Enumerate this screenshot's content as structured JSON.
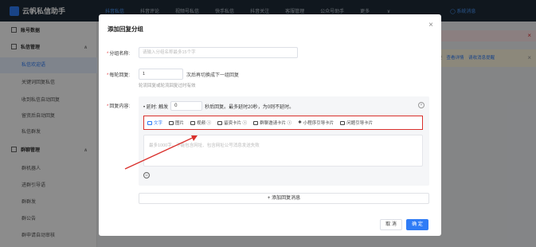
{
  "app": {
    "title": "云帆私信助手",
    "right_link": "系统消息"
  },
  "topnav": [
    "抖音私信",
    "抖音评论",
    "视频号私信",
    "快手私信",
    "抖音关注",
    "客服管理",
    "公众号助手",
    "更多"
  ],
  "sidebar": {
    "items": [
      {
        "label": "账号数据",
        "type": "group"
      },
      {
        "label": "私信管理",
        "type": "group"
      },
      {
        "label": "私信欢迎语",
        "type": "item",
        "active": true
      },
      {
        "label": "关键词回复私信",
        "type": "item"
      },
      {
        "label": "收到私信自动回复",
        "type": "item"
      },
      {
        "label": "留资后自动回复",
        "type": "item"
      },
      {
        "label": "私信群发",
        "type": "item"
      },
      {
        "label": "群聊管理",
        "type": "group"
      },
      {
        "label": "群机器人",
        "type": "item"
      },
      {
        "label": "进群引导语",
        "type": "item"
      },
      {
        "label": "群群发",
        "type": "item"
      },
      {
        "label": "群公告",
        "type": "item"
      },
      {
        "label": "群申请自动审核",
        "type": "item"
      }
    ]
  },
  "background": {
    "alert2_text": "续费",
    "alert2_link1": "查看详情",
    "alert2_link2": "请收消息提醒"
  },
  "modal": {
    "title": "添加回复分组",
    "group_name_label": "分组名称:",
    "group_name_placeholder": "请输入分组名称最多15个字",
    "rounds_label": "每轮回复:",
    "rounds_value": "1",
    "rounds_suffix": "次后再切换成下一组回复",
    "rounds_hint": "轮流回复或轮流回复过时有效",
    "content_label": "回复内容:",
    "delay_prefix": "• 延时: 触发",
    "delay_value": "0",
    "delay_suffix": "秒后回复。最多延时20秒，为0则不延时。",
    "toolbar": [
      {
        "label": "文字",
        "icon": "text-icon",
        "active": true
      },
      {
        "label": "图片",
        "icon": "image-icon"
      },
      {
        "label": "视频 ⓘ",
        "icon": "video-icon"
      },
      {
        "label": "留资卡片 ⓘ",
        "icon": "card-icon"
      },
      {
        "label": "群聊邀请卡片 ⓘ",
        "icon": "group-card-icon"
      },
      {
        "label": "小程序引导卡片",
        "icon": "miniprogram-icon"
      },
      {
        "label": "问题引导卡片",
        "icon": "question-card-icon"
      }
    ],
    "textarea_placeholder": "最多1000字。不能包含网址、包含网址公号消息发送失败",
    "add_reply_label": "+ 添加回复消息",
    "cancel_label": "取 消",
    "ok_label": "确 定"
  },
  "colors": {
    "accent": "#2f7cf6",
    "highlight_border": "#d9302c"
  }
}
